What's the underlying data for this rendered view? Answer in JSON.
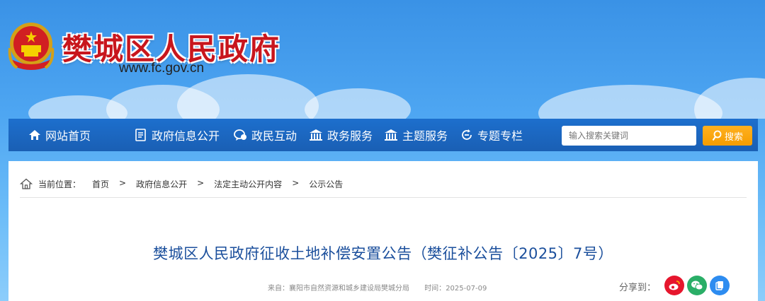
{
  "header": {
    "title": "樊城区人民政府",
    "url": "www.fc.gov.cn"
  },
  "nav": {
    "items": [
      {
        "label": "网站首页",
        "icon": "home-icon"
      },
      {
        "label": "政府信息公开",
        "icon": "document-icon"
      },
      {
        "label": "政民互动",
        "icon": "chat-icon"
      },
      {
        "label": "政务服务",
        "icon": "building-icon"
      },
      {
        "label": "主题服务",
        "icon": "building-icon"
      },
      {
        "label": "专题专栏",
        "icon": "cycle-icon"
      }
    ]
  },
  "search": {
    "placeholder": "输入搜索关键词",
    "button_label": "搜索"
  },
  "breadcrumb": {
    "label": "当前位置：",
    "separator": ">",
    "items": [
      "首页",
      "政府信息公开",
      "法定主动公开内容",
      "公示公告"
    ]
  },
  "article": {
    "title": "樊城区人民政府征收土地补偿安置公告（樊征补公告〔2025〕7号）",
    "source_label": "来自：",
    "source": "襄阳市自然资源和城乡建设局樊城分局",
    "time_label": "时间：",
    "time": "2025-07-09",
    "share_label": "分享到："
  },
  "colors": {
    "nav_bg": "#1a5fb4",
    "title_red": "#c8161d",
    "article_title": "#1b4f9c",
    "search_button": "#f59d00",
    "weibo": "#e6162d",
    "wechat": "#2aae67",
    "qzone": "#2d8cf0"
  }
}
